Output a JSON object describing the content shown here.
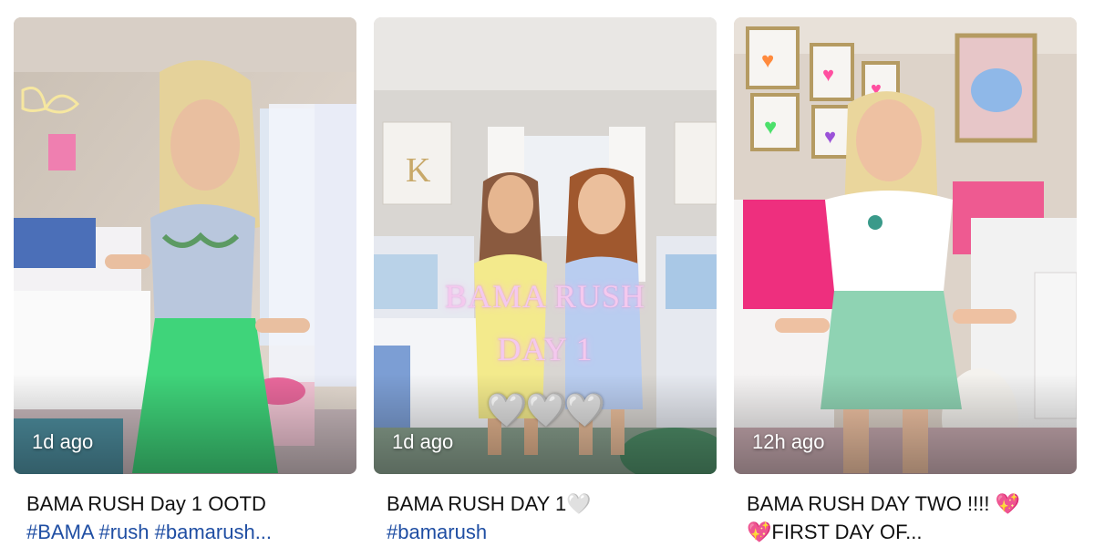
{
  "videos": [
    {
      "age": "1d ago",
      "title": "BAMA RUSH Day 1 OOTD",
      "tags": "#BAMA #rush #bamarush..."
    },
    {
      "age": "1d ago",
      "overlay_line1": "BAMA RUSH",
      "overlay_line2": "DAY 1",
      "overlay_hearts": "🤍🤍🤍",
      "title": "BAMA RUSH DAY 1🤍",
      "tags": "#bamarush"
    },
    {
      "age": "12h ago",
      "title": "BAMA RUSH DAY TWO !!!! 💖",
      "second_line": "💖FIRST DAY OF..."
    }
  ],
  "colors": {
    "hashtag": "#1f4ea3",
    "overlay_pink": "#f4c9ee"
  }
}
